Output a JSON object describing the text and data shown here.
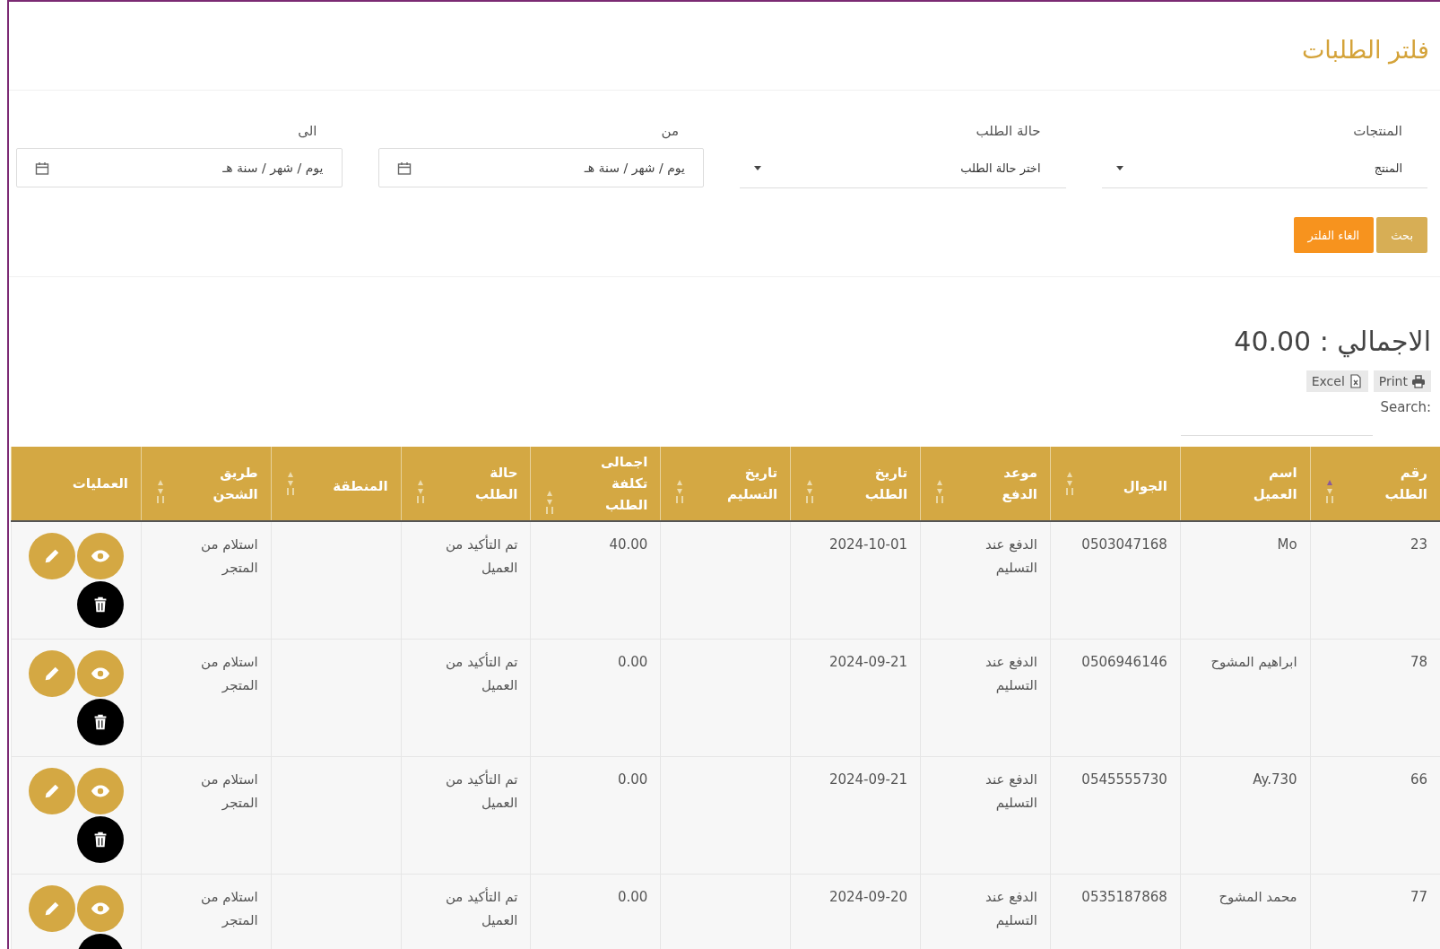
{
  "title": "فلتر الطلبات",
  "filters": [
    {
      "kind": "select",
      "label": "المنتجات",
      "value": "المنتج"
    },
    {
      "kind": "select",
      "label": "حالة الطلب",
      "value": "اختر حالة الطلب"
    },
    {
      "kind": "date",
      "label": "من",
      "placeholder": "يوم / شهر / سنة هـ"
    },
    {
      "kind": "date",
      "label": "الى",
      "placeholder": "يوم / شهر / سنة هـ"
    }
  ],
  "buttons": [
    {
      "kind": "search",
      "label": "بحث"
    },
    {
      "kind": "clear",
      "label": "الغاء الفلتر"
    }
  ],
  "total": "الاجمالي : 40.00",
  "exports": [
    {
      "kind": "print",
      "label": "Print"
    },
    {
      "kind": "excel",
      "label": "Excel"
    }
  ],
  "search": {
    "label": "Search:"
  },
  "table": {
    "columns": [
      {
        "label": "رقم الطلب",
        "kind": "sorted"
      },
      {
        "label": "اسم العميل",
        "kind": "plain"
      },
      {
        "label": "الجوال",
        "kind": "sortable"
      },
      {
        "label": "موعد الدفع",
        "kind": "sortable"
      },
      {
        "label": "تاريخ الطلب",
        "kind": "sortable"
      },
      {
        "label": "تاريخ التسليم",
        "kind": "sortable"
      },
      {
        "label": "اجمالى تكلفة الطلب",
        "kind": "sortable"
      },
      {
        "label": "حالة الطلب",
        "kind": "sortable"
      },
      {
        "label": "المنطقة",
        "kind": "sortable"
      },
      {
        "label": "طريق الشحن",
        "kind": "sortable"
      },
      {
        "label": "العمليات",
        "kind": "plain"
      }
    ],
    "rows": [
      {
        "cells": [
          "23",
          "Mo",
          "0503047168",
          "الدفع عند التسليم",
          "2024-10-01",
          "",
          "40.00",
          "تم التأكيد من العميل",
          "",
          "استلام من المتجر"
        ]
      },
      {
        "cells": [
          "78",
          "ابراهيم المشوح",
          "0506946146",
          "الدفع عند التسليم",
          "2024-09-21",
          "",
          "0.00",
          "تم التأكيد من العميل",
          "",
          "استلام من المتجر"
        ]
      },
      {
        "cells": [
          "66",
          "Ay.730",
          "0545555730",
          "الدفع عند التسليم",
          "2024-09-21",
          "",
          "0.00",
          "تم التأكيد من العميل",
          "",
          "استلام من المتجر"
        ]
      },
      {
        "cells": [
          "77",
          "محمد المشوح",
          "0535187868",
          "الدفع عند التسليم",
          "2024-09-20",
          "",
          "0.00",
          "تم التأكيد من العميل",
          "",
          "استلام من المتجر"
        ]
      }
    ]
  }
}
